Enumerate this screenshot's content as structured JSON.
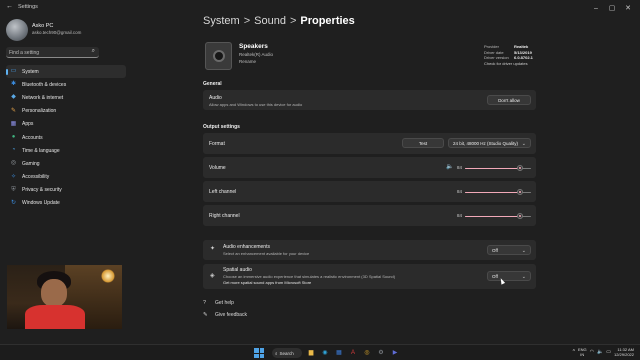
{
  "window": {
    "title": "Settings",
    "back_glyph": "←",
    "controls": [
      "–",
      "▢",
      "✕"
    ]
  },
  "user": {
    "name": "Asko PC",
    "email": "asko.tech90@gmail.com"
  },
  "search": {
    "placeholder": "Find a setting",
    "icon": "search-icon"
  },
  "nav": [
    {
      "label": "System",
      "icon": "system-icon",
      "color": "#4aa3f0",
      "active": true
    },
    {
      "label": "Bluetooth & devices",
      "icon": "bluetooth-icon",
      "color": "#3b8de0"
    },
    {
      "label": "Network & internet",
      "icon": "wifi-icon",
      "color": "#5aa9e6"
    },
    {
      "label": "Personalization",
      "icon": "brush-icon",
      "color": "#e6a34a"
    },
    {
      "label": "Apps",
      "icon": "apps-icon",
      "color": "#8c8fe6"
    },
    {
      "label": "Accounts",
      "icon": "person-icon",
      "color": "#3fb37f"
    },
    {
      "label": "Time & language",
      "icon": "globe-clock-icon",
      "color": "#4a9fe0"
    },
    {
      "label": "Gaming",
      "icon": "gamepad-icon",
      "color": "#9aa0a6"
    },
    {
      "label": "Accessibility",
      "icon": "accessibility-icon",
      "color": "#3b8de0"
    },
    {
      "label": "Privacy & security",
      "icon": "shield-icon",
      "color": "#8a8f96"
    },
    {
      "label": "Windows Update",
      "icon": "update-icon",
      "color": "#3b8de0"
    }
  ],
  "breadcrumb": {
    "parts": [
      "System",
      "Sound"
    ],
    "current": "Properties",
    "sep": ">"
  },
  "device": {
    "name": "Speakers",
    "driver_name": "Realtek(R) Audio",
    "rename": "Rename"
  },
  "driver_info": {
    "rows": [
      {
        "key": "Provider",
        "value": "Realtek"
      },
      {
        "key": "Driver date",
        "value": "5/13/2019"
      },
      {
        "key": "Driver version",
        "value": "6.0.8702.1"
      }
    ],
    "check_link": "Check for driver updates"
  },
  "general": {
    "heading": "General",
    "audio": {
      "label": "Audio",
      "sub": "Allow apps and Windows to use this device for audio",
      "button": "Don't allow"
    }
  },
  "output": {
    "heading": "Output settings",
    "format": {
      "label": "Format",
      "test_button": "Test",
      "selected": "24 bit, 48000 Hz (Studio Quality)"
    },
    "volume": {
      "label": "Volume",
      "value": "84",
      "level": 84
    },
    "left": {
      "label": "Left channel",
      "value": "84",
      "level": 84
    },
    "right": {
      "label": "Right channel",
      "value": "84",
      "level": 84
    }
  },
  "enhancements": {
    "label": "Audio enhancements",
    "sub": "Select an enhancement available for your device",
    "selected": "Off"
  },
  "spatial": {
    "label": "Spatial audio",
    "sub": "Choose an immersive audio experience that simulates a realistic environment (3D Spatial Sound)",
    "link": "Get more spatial sound apps from Microsoft Store",
    "selected": "Off"
  },
  "footer": {
    "help": "Get help",
    "feedback": "Give feedback"
  },
  "taskbar": {
    "search_label": "Search",
    "apps": [
      {
        "icon": "folder-icon",
        "glyph": "▆",
        "color": "#e9b949"
      },
      {
        "icon": "edge-icon",
        "glyph": "◉",
        "color": "#2fa4d9"
      },
      {
        "icon": "store-icon",
        "glyph": "▦",
        "color": "#3b7ddd"
      },
      {
        "icon": "pdf-icon",
        "glyph": "A",
        "color": "#d23a3a"
      },
      {
        "icon": "chrome-icon",
        "glyph": "◎",
        "color": "#e0a92a"
      },
      {
        "icon": "settings-icon",
        "glyph": "⚙",
        "color": "#8a8f96"
      },
      {
        "icon": "media-icon",
        "glyph": "▶",
        "color": "#5f6cd6"
      }
    ],
    "lang": "ENG",
    "region": "IN",
    "time": "11:32 AM",
    "date": "12/29/2022"
  }
}
